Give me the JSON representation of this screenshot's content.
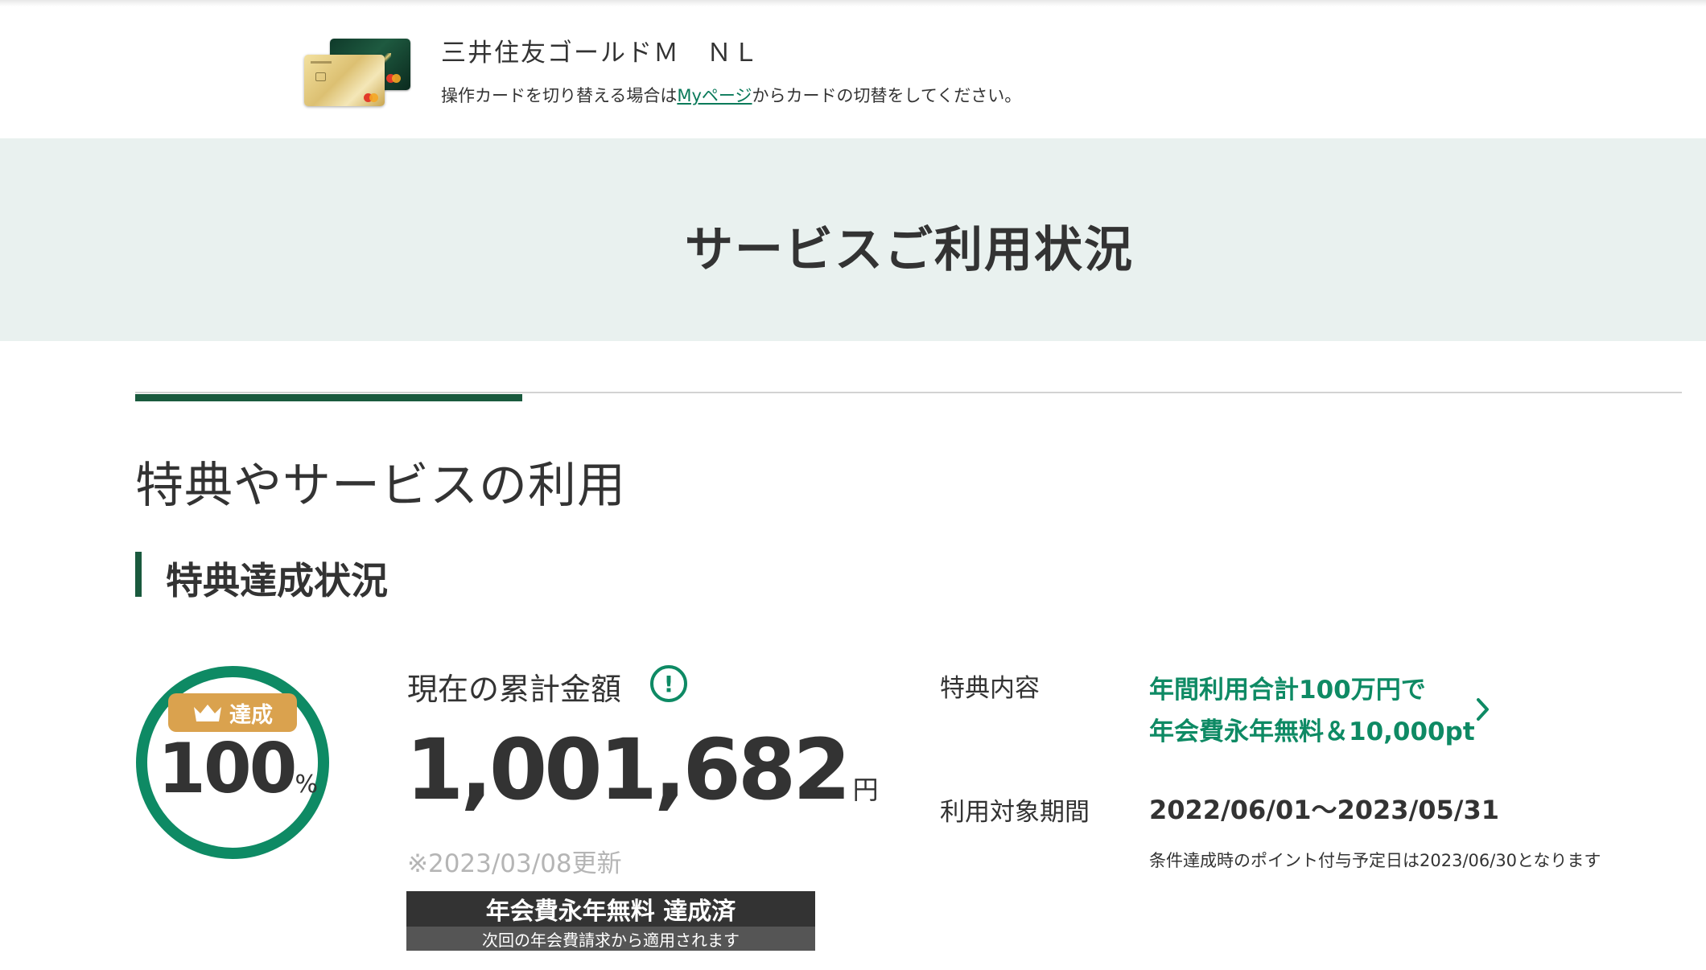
{
  "header": {
    "card_name": "三井住友ゴールドＭ　ＮＬ",
    "switch_note_before": "操作カードを切り替える場合は",
    "switch_note_link": "Myページ",
    "switch_note_after": "からカードの切替をしてください。"
  },
  "page": {
    "title": "サービスご利用状況"
  },
  "section": {
    "title": "特典やサービスの利用",
    "subtitle": "特典達成状況"
  },
  "achievement": {
    "badge_label": "達成",
    "percent_value": "100",
    "percent_unit": "%",
    "progress": 1.0
  },
  "amount": {
    "label": "現在の累計金額",
    "value": "1,001,682",
    "unit": "円",
    "updated": "※2023/03/08更新"
  },
  "status": {
    "main": "年会費永年無料 達成済",
    "sub": "次回の年会費請求から適用されます"
  },
  "benefit": {
    "label": "特典内容",
    "line1": "年間利用合計100万円で",
    "line2": "年会費永年無料＆10,000pt"
  },
  "period": {
    "label": "利用対象期間",
    "value": "2022/06/01〜2023/05/31",
    "note": "条件達成時のポイント付与予定日は2023/06/30となります"
  },
  "colors": {
    "accent_green": "#0e8a64",
    "dark_green": "#1a5a3e",
    "badge_gold": "#daa24e",
    "band_bg": "#e9f1ef"
  },
  "icons": [
    "card-image",
    "crown-icon",
    "info-icon",
    "chevron-right-icon"
  ]
}
